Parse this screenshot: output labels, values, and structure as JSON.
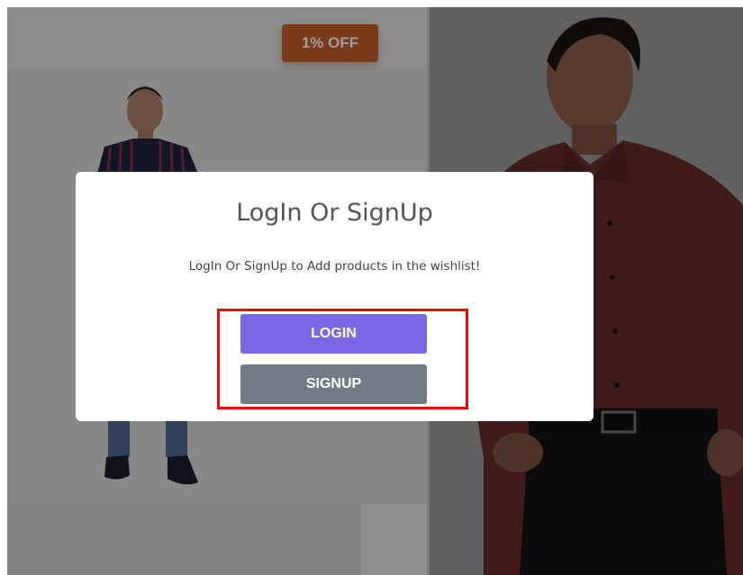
{
  "badge": {
    "label": "1% OFF"
  },
  "modal": {
    "title": "LogIn Or SignUp",
    "message": "LogIn Or SignUp to Add products in the wishlist!",
    "login_label": "LOGIN",
    "signup_label": "SIGNUP"
  },
  "colors": {
    "login": "#7a67e6",
    "signup": "#717b85",
    "badge": "#c4602a",
    "highlight": "#ff0000"
  }
}
